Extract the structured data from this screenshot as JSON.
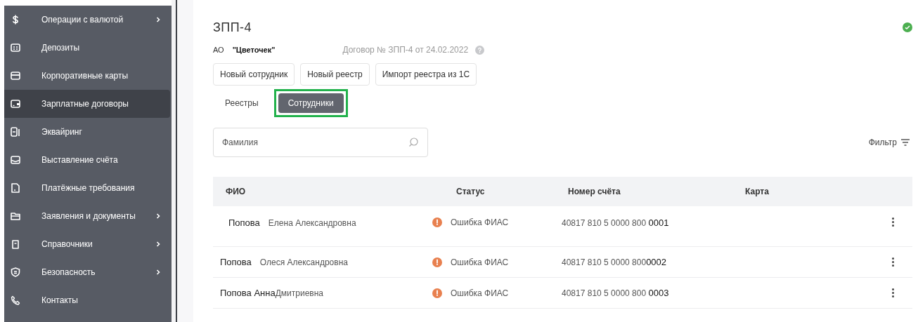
{
  "sidebar": {
    "items": [
      {
        "label": "Операции с валютой",
        "kind": "dollar",
        "selected": false,
        "has_submenu": true
      },
      {
        "label": "Депозиты",
        "kind": "deposit",
        "selected": false,
        "has_submenu": false
      },
      {
        "label": "Корпоративные карты",
        "kind": "card",
        "selected": false,
        "has_submenu": false
      },
      {
        "label": "Зарплатные договоры",
        "kind": "wallet",
        "selected": true,
        "has_submenu": false
      },
      {
        "label": "Эквайринг",
        "kind": "terminal",
        "selected": false,
        "has_submenu": false
      },
      {
        "label": "Выставление счёта",
        "kind": "envelope",
        "selected": false,
        "has_submenu": false
      },
      {
        "label": "Платёжные требования",
        "kind": "document",
        "selected": false,
        "has_submenu": false
      },
      {
        "label": "Заявления и документы",
        "kind": "folder",
        "selected": false,
        "has_submenu": true
      },
      {
        "label": "Справочники",
        "kind": "book",
        "selected": false,
        "has_submenu": true
      },
      {
        "label": "Безопасность",
        "kind": "shield",
        "selected": false,
        "has_submenu": true
      },
      {
        "label": "Контакты",
        "kind": "phone",
        "selected": false,
        "has_submenu": false
      }
    ]
  },
  "header": {
    "title": "ЗПП-4",
    "org_prefix": "АО",
    "org_name": "\"Цветочек\"",
    "contract": "Договор № ЗПП-4 от 24.02.2022",
    "status_ok": true
  },
  "actions": [
    "Новый сотрудник",
    "Новый реестр",
    "Импорт реестра из 1С"
  ],
  "tabs": [
    {
      "label": "Реестры",
      "selected": false,
      "highlighted": false
    },
    {
      "label": "Сотрудники",
      "selected": true,
      "highlighted": true
    }
  ],
  "search": {
    "placeholder": "Фамилия"
  },
  "filter": {
    "label": "Фильтр"
  },
  "table": {
    "columns": [
      "ФИО",
      "Статус",
      "Номер счёта",
      "Карта"
    ],
    "rows": [
      {
        "surname": "Попова",
        "given": "Елена Александровна",
        "status": "Ошибка ФИАС",
        "account": "40817 810 5 0000 800 **0001**"
      },
      {
        "surname": "Попова",
        "given": "Олеся Александровна",
        "status": "Ошибка ФИАС",
        "account": "40817 810 5 0000 800**0002**"
      },
      {
        "surname": "Попова Анна",
        "given": "Дмитриевна",
        "status": "Ошибка ФИАС",
        "account": "40817 810 5 0000 800 **0003**"
      }
    ]
  }
}
